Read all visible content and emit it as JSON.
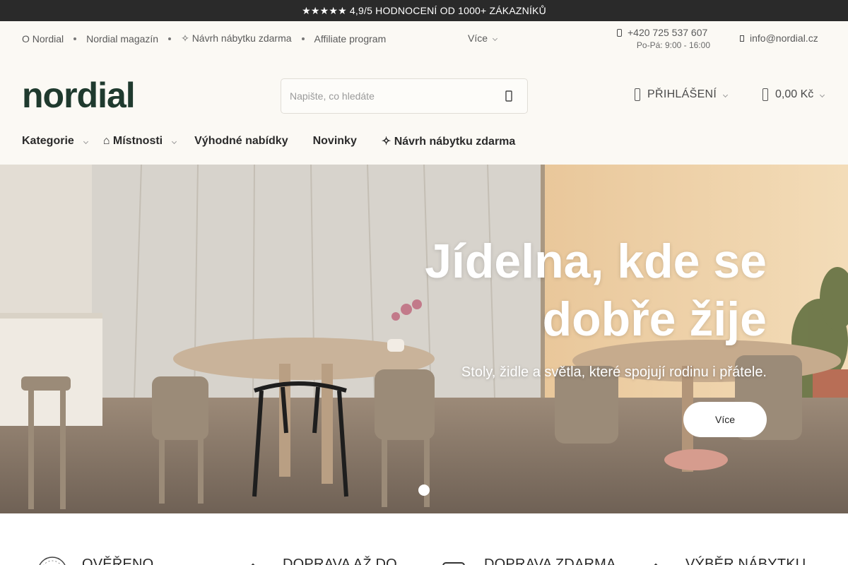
{
  "topbar": {
    "text": "★★★★★ 4,9/5 HODNOCENÍ OD 1000+ ZÁKAZNÍKŮ"
  },
  "utility": {
    "links": [
      "O Nordial",
      "Nordial magazín",
      "✧ Návrh nábytku zdarma",
      "Affiliate program"
    ],
    "more": "Více",
    "phone": "+420 725 537 607",
    "hours": "Po-Pá: 9:00 - 16:00",
    "email": "info@nordial.cz"
  },
  "header": {
    "logo": "nordial",
    "search_placeholder": "Napište, co hledáte",
    "login": "PŘIHLÁŠENÍ",
    "cart": "0,00 Kč"
  },
  "nav": {
    "items": [
      "Kategorie",
      "⌂ Místnosti",
      "Výhodné nabídky",
      "Novinky",
      "✧ Návrh nábytku zdarma"
    ]
  },
  "hero": {
    "title_line1": "Jídelna, kde se",
    "title_line2": "dobře žije",
    "subtitle": "Stoly, židle a světla, které spojují rodinu i přátele.",
    "cta": "Více"
  },
  "usps": [
    "OVĚŘENO",
    "DOPRAVA AŽ DO",
    "DOPRAVA ZDARMA",
    "VÝBĚR NÁBYTKU"
  ],
  "icons": [
    "phone-icon",
    "mail-icon",
    "search-icon",
    "user-icon",
    "cart-icon",
    "chevron-down-icon"
  ],
  "colors": {
    "brand": "#1f3a2e",
    "topbar": "#2a2a2a",
    "background": "#fbf9f4"
  }
}
